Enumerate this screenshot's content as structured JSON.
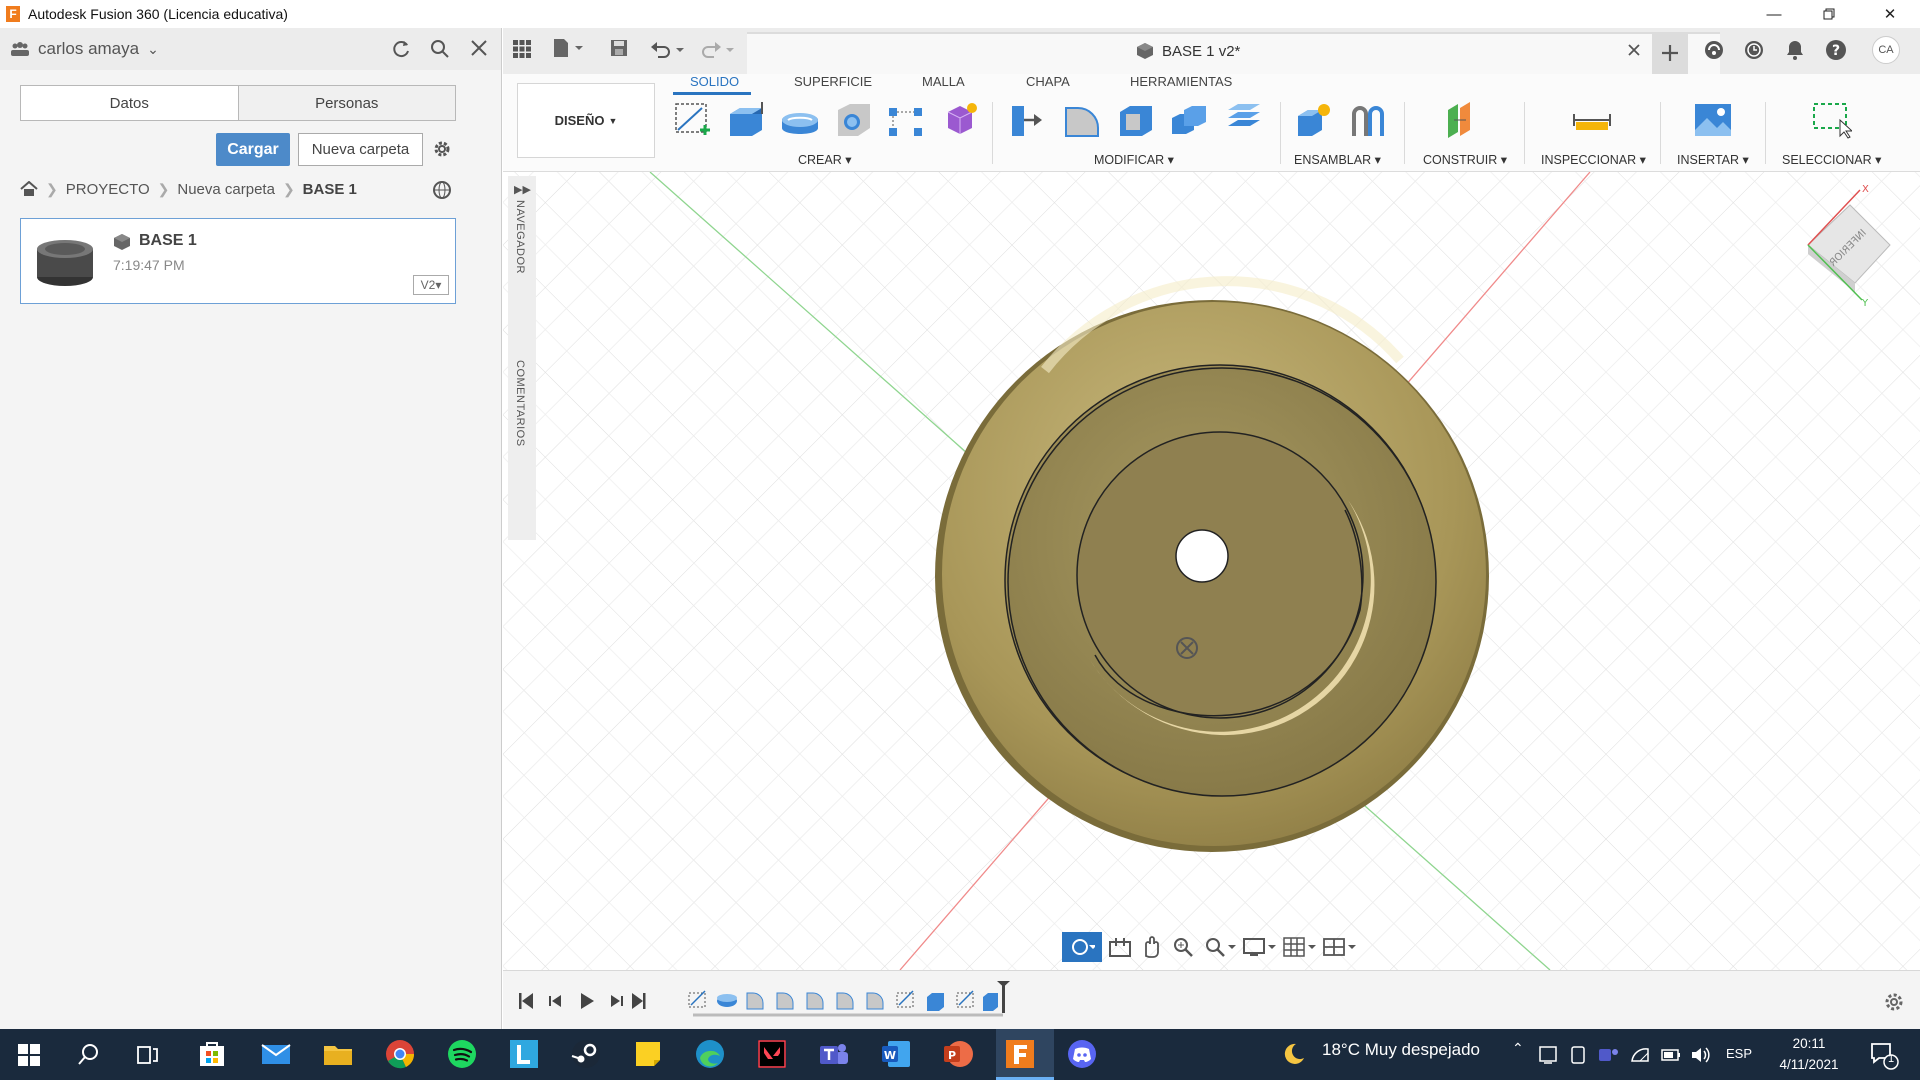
{
  "window": {
    "title": "Autodesk Fusion 360 (Licencia educativa)",
    "logo_letter": "F",
    "accent": "#f07c1d"
  },
  "left_panel": {
    "user": "carlos amaya",
    "tabs": [
      "Datos",
      "Personas"
    ],
    "upload_label": "Cargar",
    "new_folder_label": "Nueva carpeta",
    "breadcrumb": [
      "PROYECTO",
      "Nueva carpeta",
      "BASE 1"
    ],
    "file": {
      "name": "BASE 1",
      "time": "7:19:47 PM",
      "version": "V2"
    }
  },
  "document": {
    "title": "BASE 1 v2*",
    "user_initials": "CA"
  },
  "ribbon": {
    "workspace": "DISEÑO",
    "tabs": [
      "SOLIDO",
      "SUPERFICIE",
      "MALLA",
      "CHAPA",
      "HERRAMIENTAS"
    ],
    "active_tab": "SOLIDO",
    "groups": [
      "CREAR",
      "MODIFICAR",
      "ENSAMBLAR",
      "CONSTRUIR",
      "INSPECCIONAR",
      "INSERTAR",
      "SELECCIONAR"
    ]
  },
  "side_panel": {
    "browser_label": "NAVEGADOR",
    "comments_label": "COMENTARIOS"
  },
  "viewcube": {
    "face": "INFERIOR"
  },
  "taskbar": {
    "weather": "18°C  Muy despejado",
    "language": "ESP",
    "time": "20:11",
    "date": "4/11/2021",
    "notifications": "1"
  },
  "colors": {
    "part_fill": "#b3a46b",
    "part_light": "#e9dcb0",
    "part_dark": "#8a7c46",
    "accent_blue": "#2a74c0",
    "taskbar": "#1a2a3d"
  }
}
